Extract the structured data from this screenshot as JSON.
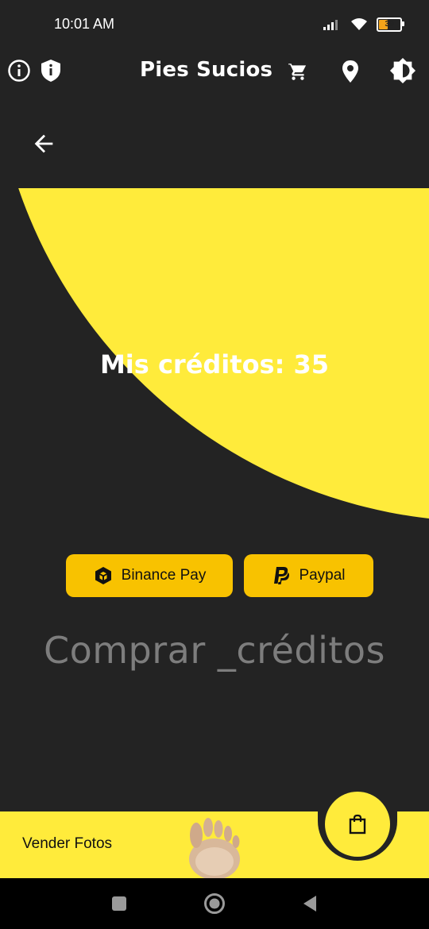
{
  "status_bar": {
    "time": "10:01 AM",
    "battery_level": "39",
    "icons": [
      "signal-icon",
      "wifi-icon",
      "battery-icon"
    ]
  },
  "app_bar": {
    "title": "Pies Sucios",
    "left_icons": [
      "info-icon",
      "shield-icon"
    ],
    "right_icons": [
      "cart-icon",
      "location-icon",
      "brightness-icon"
    ]
  },
  "page": {
    "back_icon": "arrow-back-icon",
    "credits_text": "Mis créditos: 35",
    "buy_title": "Comprar _créditos"
  },
  "payment": {
    "binance_label": "Binance Pay",
    "paypal_label": "Paypal"
  },
  "bottom_nav": {
    "sell_label": "Vender Fotos",
    "fab_icon": "shopping-bag-icon"
  },
  "system_nav": [
    "recents-icon",
    "home-icon",
    "back-icon"
  ],
  "colors": {
    "background": "#232323",
    "accent_yellow": "#ffeb3b",
    "button_yellow": "#f8c200",
    "muted_text": "#7d7d7d"
  }
}
